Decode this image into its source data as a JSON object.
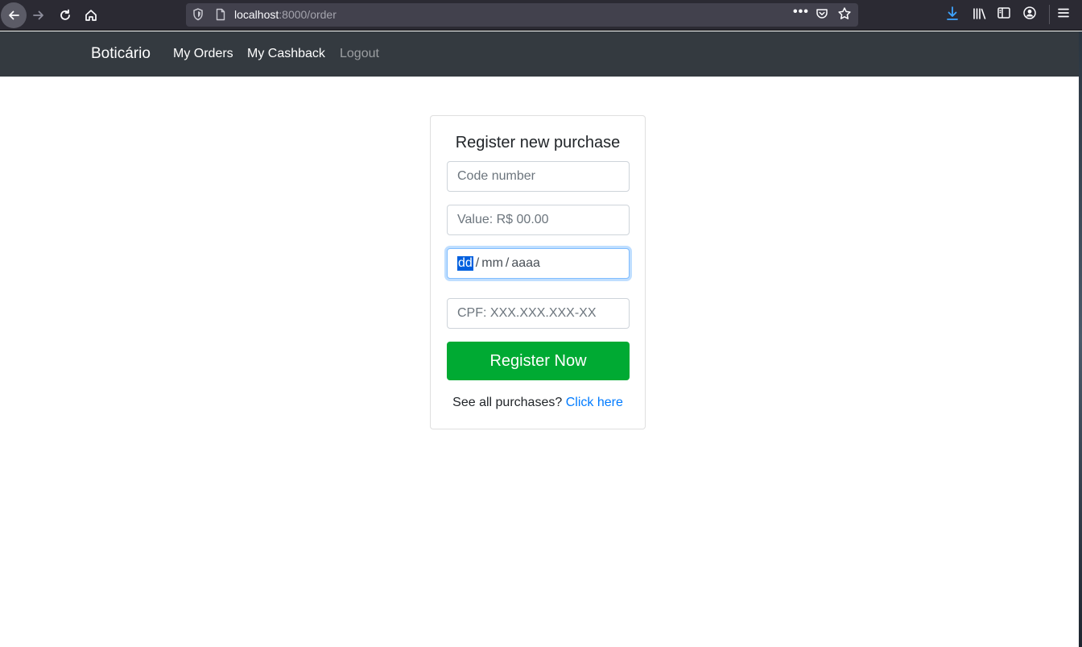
{
  "browser": {
    "url_host": "localhost",
    "url_rest": ":8000/order",
    "more_dots": "•••"
  },
  "navbar": {
    "brand": "Boticário",
    "links": [
      {
        "label": "My Orders"
      },
      {
        "label": "My Cashback"
      },
      {
        "label": "Logout"
      }
    ]
  },
  "form": {
    "title": "Register new purchase",
    "code_placeholder": "Code number",
    "value_placeholder": "Value: R$ 00.00",
    "date": {
      "day": "dd",
      "month": "mm",
      "year": "aaaa",
      "separator": "/"
    },
    "cpf_placeholder": "CPF: XXX.XXX.XXX-XX",
    "submit_label": "Register Now",
    "footer_text": "See all purchases?",
    "footer_link": "Click here"
  }
}
